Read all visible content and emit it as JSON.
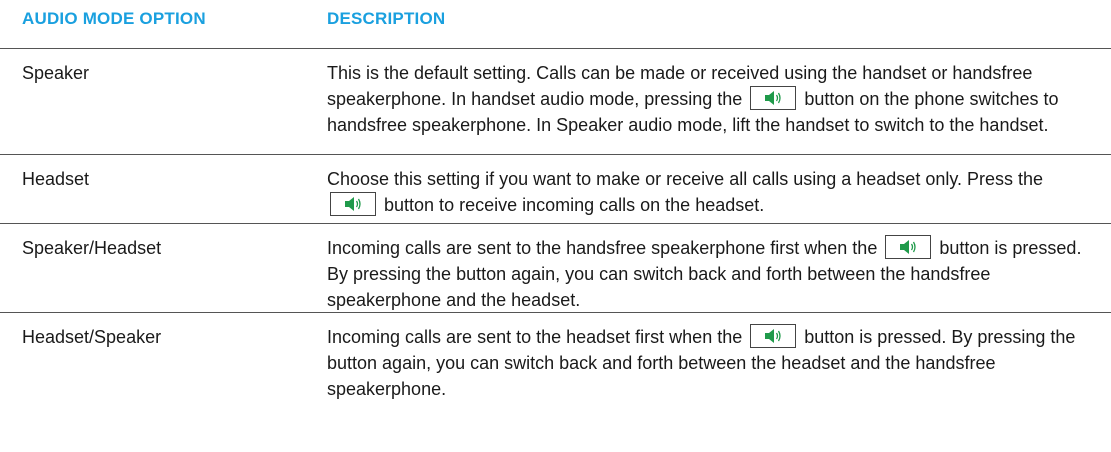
{
  "header": {
    "col1": "AUDIO MODE OPTION",
    "col2": "DESCRIPTION"
  },
  "icons": {
    "speaker_button": "speaker-icon",
    "speaker_color": "#1f9a4a"
  },
  "colors": {
    "header_text": "#1aa0df",
    "rule": "#555555"
  },
  "rows": [
    {
      "option": "Speaker",
      "desc_part1": "This is the default setting. Calls can be made or received using the handset or handsfree speakerphone. In handset audio mode, pressing the",
      "desc_part2": "button on the phone switches to handsfree speakerphone. In Speaker audio mode, lift the handset to switch to the handset."
    },
    {
      "option": "Headset",
      "desc_part1": "Choose this setting if you want to make or receive all calls using a headset only. Press the",
      "desc_part2": "button to receive incoming calls on the headset."
    },
    {
      "option": "Speaker/Headset",
      "desc_part1": "Incoming calls are sent to the handsfree speakerphone first when the",
      "desc_part2": "button is pressed. By pressing the button again, you can switch back and forth between the handsfree speakerphone and the headset."
    },
    {
      "option": "Headset/Speaker",
      "desc_part1": "Incoming calls are sent to the headset first when the",
      "desc_part2": "button is pressed. By pressing the button again, you can switch back and forth between the headset and the handsfree speakerphone."
    }
  ]
}
